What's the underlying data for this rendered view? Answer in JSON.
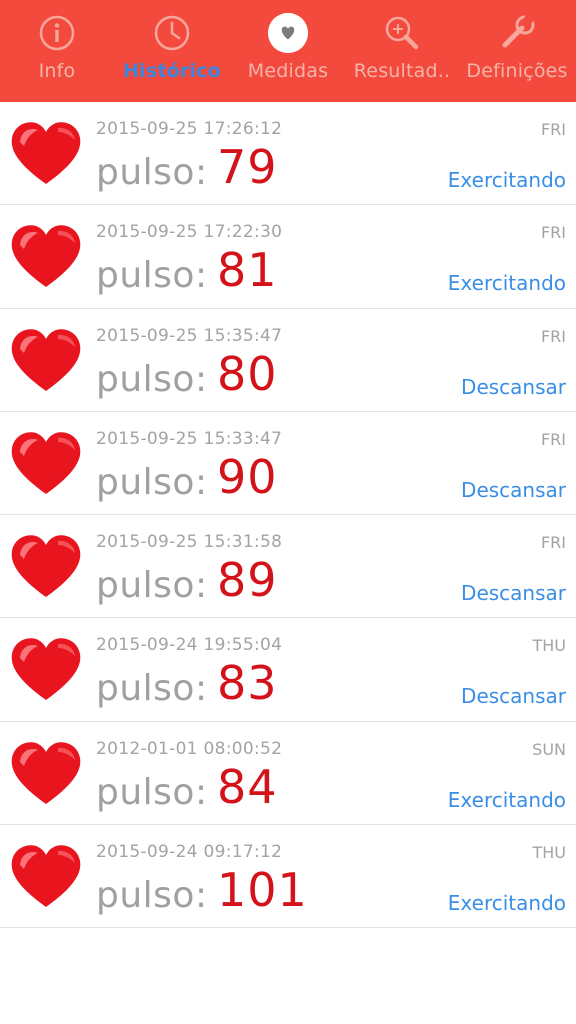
{
  "tabs": [
    {
      "label": "Info",
      "icon": "info-icon",
      "active": false
    },
    {
      "label": "Histórico",
      "icon": "clock-icon",
      "active": true
    },
    {
      "label": "Medidas",
      "icon": "heart-circle-icon",
      "active": false
    },
    {
      "label": "Resultad..",
      "icon": "magnifier-icon",
      "active": false
    },
    {
      "label": "Definições",
      "icon": "wrench-icon",
      "active": false
    }
  ],
  "pulse_label": "pulso:",
  "records": [
    {
      "timestamp": "2015-09-25 17:26:12",
      "day": "FRI",
      "value": "79",
      "state": "Exercitando"
    },
    {
      "timestamp": "2015-09-25 17:22:30",
      "day": "FRI",
      "value": "81",
      "state": "Exercitando"
    },
    {
      "timestamp": "2015-09-25 15:35:47",
      "day": "FRI",
      "value": "80",
      "state": "Descansar"
    },
    {
      "timestamp": "2015-09-25 15:33:47",
      "day": "FRI",
      "value": "90",
      "state": "Descansar"
    },
    {
      "timestamp": "2015-09-25 15:31:58",
      "day": "FRI",
      "value": "89",
      "state": "Descansar"
    },
    {
      "timestamp": "2015-09-24 19:55:04",
      "day": "THU",
      "value": "83",
      "state": "Descansar"
    },
    {
      "timestamp": "2012-01-01 08:00:52",
      "day": "SUN",
      "value": "84",
      "state": "Exercitando"
    },
    {
      "timestamp": "2015-09-24 09:17:12",
      "day": "THU",
      "value": "101",
      "state": "Exercitando"
    }
  ],
  "colors": {
    "header": "#f44a3e",
    "active_tab": "#3a86dc",
    "pulse_value": "#d4121a",
    "state": "#3a8ee6"
  }
}
